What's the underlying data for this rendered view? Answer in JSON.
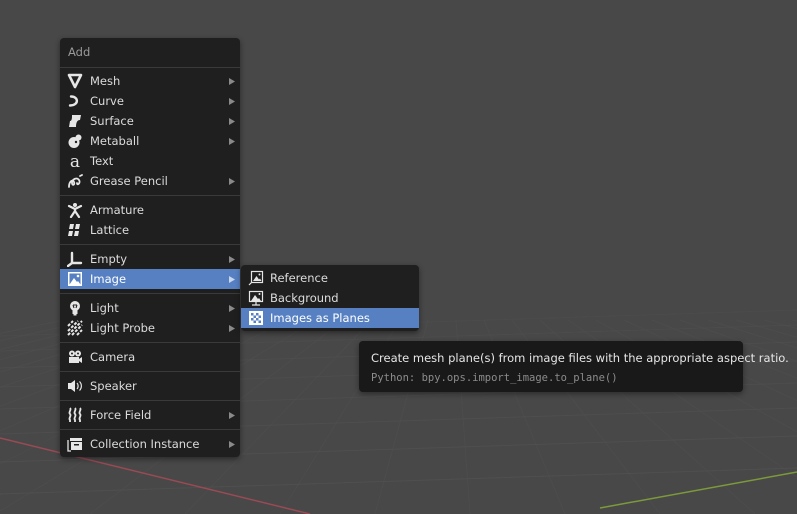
{
  "viewport": {
    "background_color": "#484848",
    "x_axis_color": "#9a4a55",
    "y_axis_color": "#7d9a3a"
  },
  "add_menu": {
    "title": "Add",
    "highlight_color": "#5680c2",
    "items": [
      {
        "label": "Mesh",
        "icon": "mesh-icon",
        "submenu": true
      },
      {
        "label": "Curve",
        "icon": "curve-icon",
        "submenu": true
      },
      {
        "label": "Surface",
        "icon": "surface-icon",
        "submenu": true
      },
      {
        "label": "Metaball",
        "icon": "metaball-icon",
        "submenu": true
      },
      {
        "label": "Text",
        "icon": "text-icon",
        "submenu": false
      },
      {
        "label": "Grease Pencil",
        "icon": "grease-pencil-icon",
        "submenu": true
      },
      {
        "label": "Armature",
        "icon": "armature-icon",
        "submenu": false
      },
      {
        "label": "Lattice",
        "icon": "lattice-icon",
        "submenu": false
      },
      {
        "label": "Empty",
        "icon": "empty-icon",
        "submenu": true
      },
      {
        "label": "Image",
        "icon": "image-icon",
        "submenu": true,
        "active": true
      },
      {
        "label": "Light",
        "icon": "light-icon",
        "submenu": true
      },
      {
        "label": "Light Probe",
        "icon": "light-probe-icon",
        "submenu": true
      },
      {
        "label": "Camera",
        "icon": "camera-icon",
        "submenu": false
      },
      {
        "label": "Speaker",
        "icon": "speaker-icon",
        "submenu": false
      },
      {
        "label": "Force Field",
        "icon": "force-field-icon",
        "submenu": true
      },
      {
        "label": "Collection Instance",
        "icon": "collection-instance-icon",
        "submenu": true
      }
    ]
  },
  "image_submenu": {
    "items": [
      {
        "label": "Reference",
        "icon": "image-reference-icon"
      },
      {
        "label": "Background",
        "icon": "image-background-icon"
      },
      {
        "label": "Images as Planes",
        "icon": "images-as-planes-icon",
        "active": true
      }
    ]
  },
  "tooltip": {
    "description": "Create mesh plane(s) from image files with the appropriate aspect ratio.",
    "python": "Python: bpy.ops.import_image.to_plane()"
  }
}
